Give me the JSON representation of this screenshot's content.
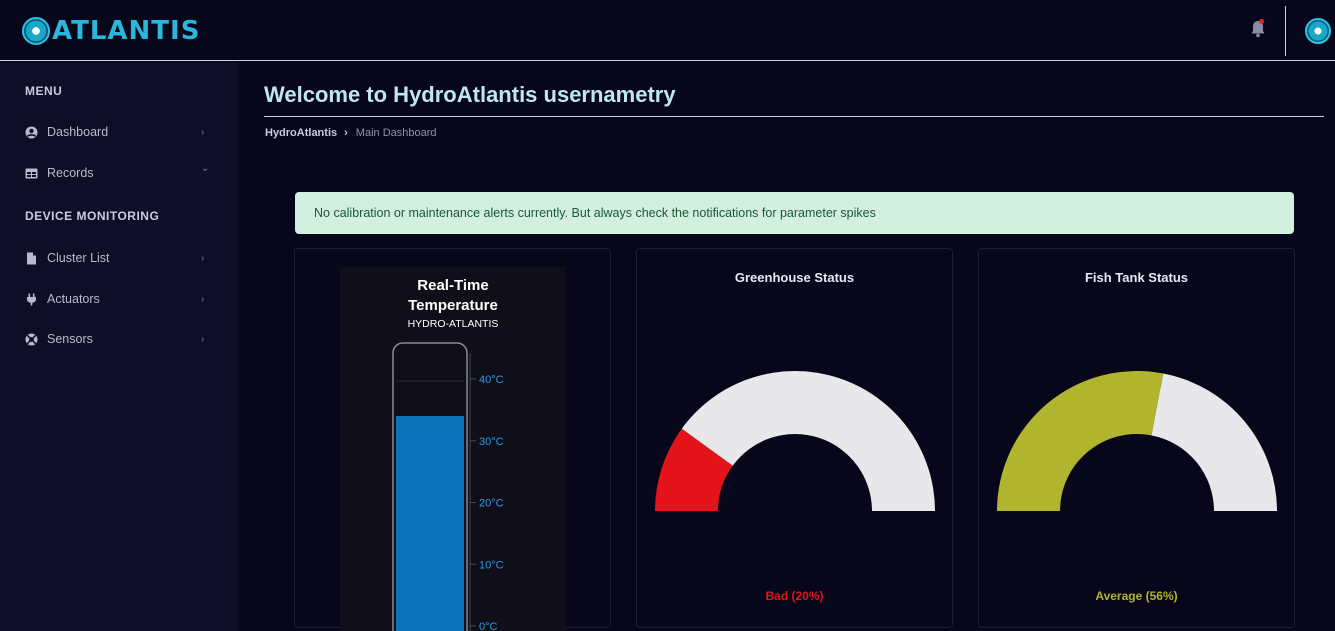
{
  "brand": {
    "name": "ATLANTIS"
  },
  "header": {
    "notification_icon": "bell-icon",
    "notification_dot_color": "#e0252a"
  },
  "sidebar": {
    "section_menu": "MENU",
    "section_devices": "DEVICE MONITORING",
    "items": [
      {
        "label": "Dashboard",
        "icon": "user-circle-icon",
        "chevron": "›"
      },
      {
        "label": "Records",
        "icon": "table-icon",
        "chevron": "⌄"
      },
      {
        "label": "Cluster List",
        "icon": "file-icon",
        "chevron": "›"
      },
      {
        "label": "Actuators",
        "icon": "plug-icon",
        "chevron": "›"
      },
      {
        "label": "Sensors",
        "icon": "lifebuoy-icon",
        "chevron": "›"
      }
    ]
  },
  "main": {
    "title": "Welcome to HydroAtlantis usernametry",
    "breadcrumb": {
      "home": "HydroAtlantis",
      "separator": "›",
      "current": "Main Dashboard"
    },
    "alert": "No calibration or maintenance alerts currently. But always check the notifications for parameter spikes"
  },
  "thermometer": {
    "title_line1": "Real-Time",
    "title_line2": "Temperature",
    "subtitle": "HYDRO-ATLANTIS",
    "ticks": [
      "40°C",
      "30°C",
      "20°C",
      "10°C",
      "0°C"
    ],
    "fill_color": "#0a73b9",
    "value": 34
  },
  "greenhouse": {
    "title": "Greenhouse Status",
    "status": "Bad (20%)",
    "percent": 20,
    "color": "#e31319"
  },
  "fishtank": {
    "title": "Fish Tank Status",
    "status": "Average (56%)",
    "percent": 56,
    "color": "#b1b52e"
  }
}
